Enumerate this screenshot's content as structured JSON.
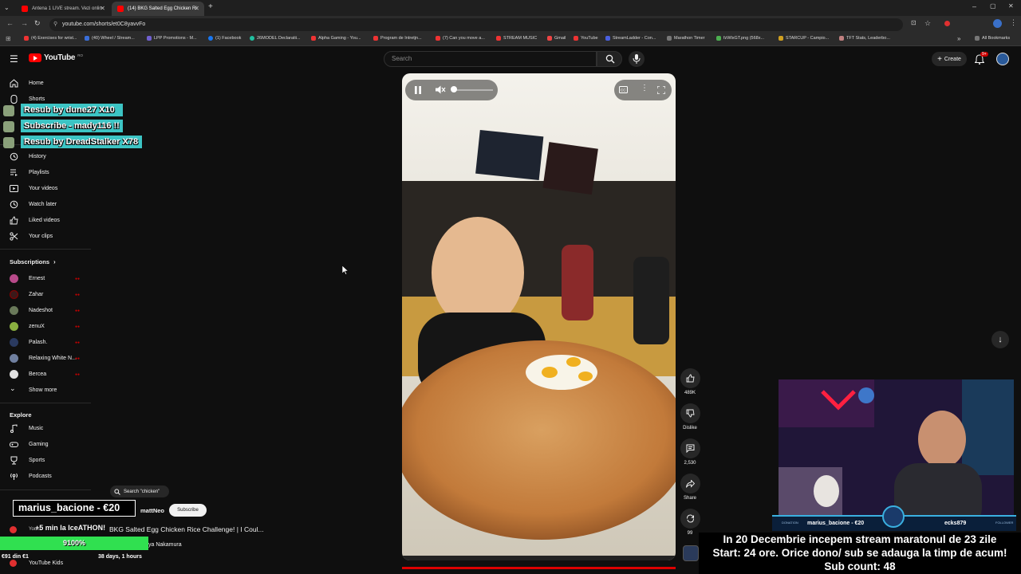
{
  "browser": {
    "tabs": [
      {
        "title": "Antena 1 LIVE stream. Vezi onlin"
      },
      {
        "title": "(14) BKG Salted Egg Chicken Ri"
      }
    ],
    "url": "youtube.com/shorts/et0C8yavvFo",
    "bookmarks": [
      "(4) Exercises for wrist...",
      "(40) Wheel / Stream...",
      "LPP Promotions - M...",
      "(1) Facebook",
      "26MODEL Declaratii...",
      "Alpha Gaming - You...",
      "Program de Intretjn...",
      "(7) Can you move a...",
      "STREAM MUSIC",
      "Gmail",
      "YouTube",
      "StreamLadder - Con...",
      "Marathon Timer",
      "fzWlxGT.png (568x...",
      "STARCUP - Campio...",
      "TFT Stats, Leaderbo..."
    ],
    "all_bookmarks": "All Bookmarks"
  },
  "masthead": {
    "logo": "YouTube",
    "region": "RO",
    "search_placeholder": "Search",
    "create_label": "Create",
    "notification_count": "9+"
  },
  "sidebar": {
    "main": [
      {
        "label": "Home",
        "icon": "home-icon"
      },
      {
        "label": "Shorts",
        "icon": "shorts-icon"
      }
    ],
    "you": [
      {
        "label": "History",
        "icon": "history-icon"
      },
      {
        "label": "Playlists",
        "icon": "playlists-icon"
      },
      {
        "label": "Your videos",
        "icon": "your-videos-icon"
      },
      {
        "label": "Watch later",
        "icon": "watch-later-icon"
      },
      {
        "label": "Liked videos",
        "icon": "liked-videos-icon"
      },
      {
        "label": "Your clips",
        "icon": "clips-icon"
      }
    ],
    "subscriptions_title": "Subscriptions",
    "subscriptions": [
      {
        "label": "Ernest",
        "color": "#b84a8a"
      },
      {
        "label": "Zahar",
        "color": "#3a1a1a"
      },
      {
        "label": "Nadeshot",
        "color": "#6a7a5a"
      },
      {
        "label": "zenuX",
        "color": "#8ab040"
      },
      {
        "label": "Palash.",
        "color": "#2a3a60"
      },
      {
        "label": "Relaxing White N...",
        "color": "#7080a0"
      },
      {
        "label": "Bercea",
        "color": "#e0e0e0"
      }
    ],
    "show_more": "Show more",
    "explore_title": "Explore",
    "explore": [
      {
        "label": "Music",
        "icon": "music-icon"
      },
      {
        "label": "Gaming",
        "icon": "gaming-icon"
      },
      {
        "label": "Sports",
        "icon": "sports-icon"
      },
      {
        "label": "Podcasts",
        "icon": "podcasts-icon"
      }
    ],
    "youtube_kids": "YouTube Kids"
  },
  "stream_alerts": [
    "Resub by dune27 X10",
    "Subscribe - mady116 !!",
    "Resub by DreadStalker X78"
  ],
  "short": {
    "search_chip": "Search \"chicken\"",
    "channel": "mattNeo",
    "subscribe_label": "Subscribe",
    "title": "BKG Salted Egg Chicken Rice Challenge! | I Coul...",
    "credit": "ya Nakamura",
    "likes": "489K",
    "dislike_label": "Dislike",
    "comments": "2,530",
    "share_label": "Share",
    "remix_count": "99"
  },
  "overlay": {
    "donor_banner": "marius_bacione - €20",
    "marathon_label": "+5 min la IceATHON!",
    "goal_percent_label": "9100%",
    "goal_percent": 1.0,
    "goal_amount": "€91 din €1",
    "time_left": "38 days, 1 hours",
    "cam_bar_left": "marius_bacione - €20",
    "cam_bar_right": "ecks879",
    "cam_bar_tag_left": "DONATION",
    "cam_bar_tag_right": "FOLLOWER",
    "ticker_lines": [
      "In 20 Decembrie incepem stream maratonul de 23 zile",
      "Start: 24 ore. Orice dono/ sub se adauga la timp de acum!",
      "Sub count: 48"
    ]
  }
}
